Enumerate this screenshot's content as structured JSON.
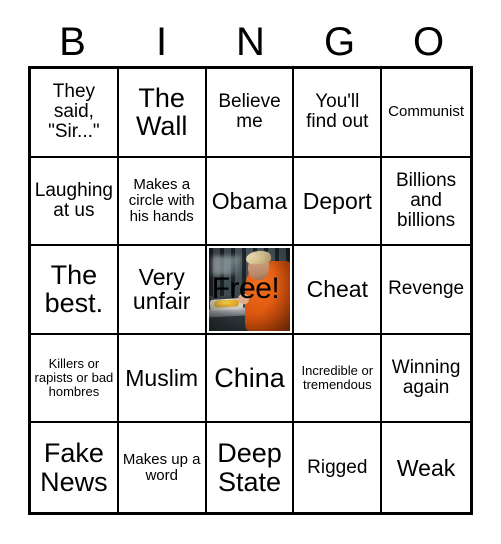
{
  "card": {
    "header_letters": [
      "B",
      "I",
      "N",
      "G",
      "O"
    ],
    "free_space": {
      "label": "Free!",
      "image_description": "Photo of a man with blonde hair in an orange prison jumpsuit eating a meal at a metal table in front of jail bars",
      "label_color": "#000000"
    },
    "colors": {
      "border": "#000000",
      "background": "#ffffff",
      "text": "#000000",
      "jumpsuit_orange": "#d9530d"
    },
    "rows": [
      [
        {
          "text": "They said, \"Sir...\"",
          "size": "md"
        },
        {
          "text": "The Wall",
          "size": "xl"
        },
        {
          "text": "Believe me",
          "size": "md"
        },
        {
          "text": "You'll find out",
          "size": "md"
        },
        {
          "text": "Communist",
          "size": "sm"
        }
      ],
      [
        {
          "text": "Laughing at us",
          "size": "md"
        },
        {
          "text": "Makes a circle with his hands",
          "size": "sm"
        },
        {
          "text": "Obama",
          "size": "lg"
        },
        {
          "text": "Deport",
          "size": "lg"
        },
        {
          "text": "Billions and billions",
          "size": "md"
        }
      ],
      [
        {
          "text": "The best.",
          "size": "xl"
        },
        {
          "text": "Very unfair",
          "size": "lg"
        },
        {
          "text": "Free!",
          "size": "free"
        },
        {
          "text": "Cheat",
          "size": "lg"
        },
        {
          "text": "Revenge",
          "size": "md"
        }
      ],
      [
        {
          "text": "Killers or rapists or bad hombres",
          "size": "xs"
        },
        {
          "text": "Muslim",
          "size": "lg"
        },
        {
          "text": "China",
          "size": "xl"
        },
        {
          "text": "Incredible or tremendous",
          "size": "xs"
        },
        {
          "text": "Winning again",
          "size": "md"
        }
      ],
      [
        {
          "text": "Fake News",
          "size": "xl"
        },
        {
          "text": "Makes up a word",
          "size": "sm"
        },
        {
          "text": "Deep State",
          "size": "xl"
        },
        {
          "text": "Rigged",
          "size": "md"
        },
        {
          "text": "Weak",
          "size": "lg"
        }
      ]
    ]
  }
}
